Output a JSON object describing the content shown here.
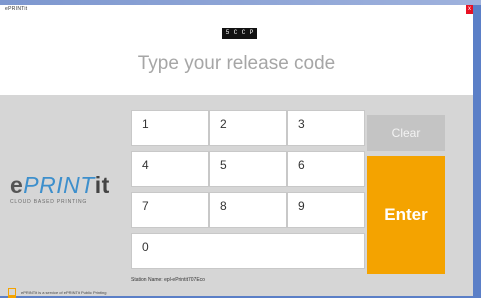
{
  "window": {
    "title": "ePRINTit",
    "close_label": "x"
  },
  "release": {
    "code_digits": [
      "5",
      "C",
      "C",
      "P"
    ],
    "prompt": "Type your release code"
  },
  "logo": {
    "brand_e": "e",
    "brand_print": "PRINT",
    "brand_it": "it",
    "tagline": "CLOUD BASED PRINTING"
  },
  "keypad": {
    "keys": [
      "1",
      "2",
      "3",
      "4",
      "5",
      "6",
      "7",
      "8",
      "9",
      "0"
    ],
    "clear_label": "Clear",
    "enter_label": "Enter"
  },
  "station": {
    "label": "Station Name: epl-ePrintit707Eco"
  },
  "footer": {
    "text": "ePRINTit is a service of ePRINTit Public Printing"
  },
  "colors": {
    "accent": "#f4a300",
    "clear": "#c4c4c4",
    "desktop": "#5b7fc7",
    "brand_blue": "#3d8fcc"
  }
}
